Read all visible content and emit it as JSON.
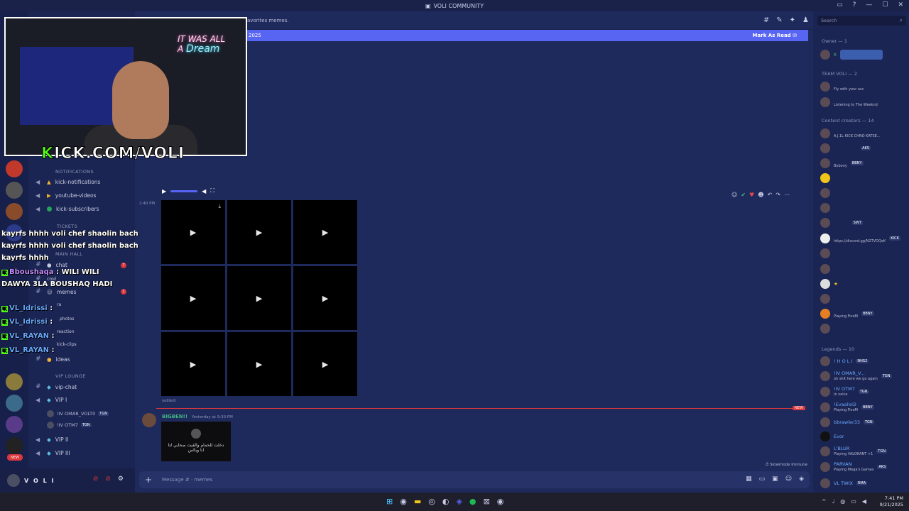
{
  "window": {
    "title": "VOLI COMMUNITY"
  },
  "header": {
    "topic": "avorites memes."
  },
  "newbar": {
    "left_text": "2025",
    "mark_read": "Mark As Read"
  },
  "sidebar": {
    "cat_notifications": "NOTIFICATIONS",
    "kick_notifications": "kick-notifications",
    "youtube_videos": "youtube-videos",
    "kick_subscribers": "kick-subscribers",
    "cat_tickets": "TICKETS",
    "cat_main_hall": "MAIN HALL",
    "chat": "chat",
    "cmd": "cmd",
    "memes": "memes",
    "ra": "ra",
    "photos": "photos",
    "reaction": "reaction",
    "kick_clips": "kick-clips",
    "ideas": "ideas",
    "cat_vip": "VIP LOUNGE",
    "vip_chat": "vip-chat",
    "vip1": "VIP I",
    "vip1_user1": "!IV OMAR_VOLT0",
    "vip1_user1_tag": "TGN",
    "vip1_user2": "!IV OTM7",
    "vip1_user2_tag": "TGN",
    "vip2": "VIP II",
    "vip3": "VIP III",
    "badge_chat": "7",
    "badge_memes": "1",
    "new_label": "NEW"
  },
  "user": {
    "name": "V O L I"
  },
  "messages": {
    "ts1": "2:40 PM",
    "edited": "(edited)",
    "new_label": "NEW",
    "msg2_name": "BIGBEN!!",
    "msg2_time": "Yesterday at 9:30 PM",
    "thumb_text": "دخلت للحمام والقيت صحابي لتا",
    "thumb_text2": "انا ويااس",
    "slowmode": "Slowmode Immune"
  },
  "composer": {
    "placeholder": "Message #  · memes"
  },
  "members": {
    "search_placeholder": "Search",
    "owner_header": "Owner — 1",
    "team_header": "TEAM VOLI — 2",
    "team1_sub": "Fly with your ass",
    "team2_sub": "Listening to The Weeknd",
    "cc_header": "Content creators — 14",
    "cc1_sub": "A.J.1L KICK CHNO KATSE...",
    "cc3_tag": "BBNY",
    "cc3_sub": "Bobony",
    "cc_aks": "AKS",
    "cc_swt": "SWT",
    "cc_kick": "KICK",
    "cc_link": "https://discord.gg/N2TVDQeK",
    "cc_bbny": "BBNY",
    "cc_fivem": "Playing FiveM",
    "legends_header": "Legends — 10",
    "l1": "! H O L I",
    "l1_tag": "NHS2",
    "l2": "!IV OMAR_V...",
    "l2_tag": "TGN",
    "l2_sub": "oh shit here we go again",
    "l3": "!IV OTM7",
    "l3_tag": "TGN",
    "l3_sub": "In voice",
    "l4": "!Evaallol2",
    "l4_tag": "BBNY",
    "l4_sub": "Playing FiveM",
    "l5": "bbrawler33",
    "l5_tag": "TGN",
    "l6": "Evor",
    "l7": "L'BLUR",
    "l7_tag": "TGN",
    "l7_sub": "Playing VALORANT +1",
    "l8": "PARVAN",
    "l8_tag": "AKS",
    "l8_sub": "Playing Mega's Games",
    "l9": "VL TWIX",
    "l9_tag": "RMA"
  },
  "overlay": {
    "kick_k": "K",
    "kick_rest": "ICK.COM/VOLI",
    "neon1": "IT WAS ALL",
    "neon2": "A",
    "neon3": "Dream",
    "c1": "kayrfs hhhh voli chef shaolin bach",
    "c2": "kayrfs hhhh voli chef shaolin bach",
    "c3": "kayrfs hhhh",
    "c4_user": "Bboushaqa",
    "c4_msg": ": WILI WILI",
    "c5": "DAWYA 3LA BOUSHAQ HADI",
    "c6_user": "VL_Idrissi",
    "c6_msg": ":",
    "c7_user": "VL_Idrissi",
    "c7_msg": ":",
    "c8_user": "VL_RAYAN",
    "c8_msg": ":",
    "c9_user": "VL_RAYAN",
    "c9_msg": ":"
  },
  "taskbar": {
    "time": "7:41 PM",
    "date": "9/21/2025"
  }
}
